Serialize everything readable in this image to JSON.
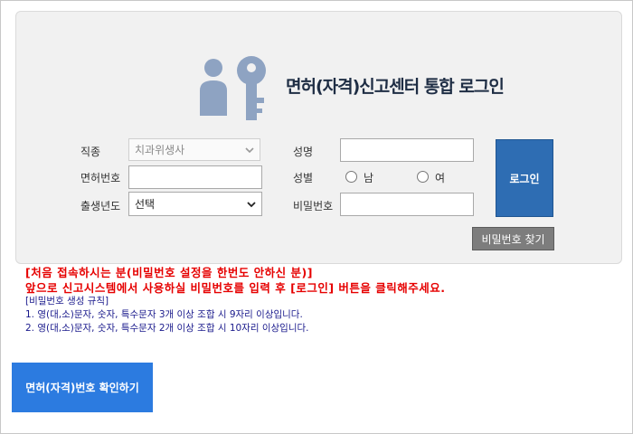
{
  "header": {
    "title": "면허(자격)신고센터 통합 로그인",
    "logo_icon": "user-key-icon"
  },
  "form": {
    "job": {
      "label": "직종",
      "selected": "치과위생사",
      "disabled": true
    },
    "license_no": {
      "label": "면허번호",
      "value": ""
    },
    "birth_year": {
      "label": "출생년도",
      "selected": "선택"
    },
    "name": {
      "label": "성명",
      "value": ""
    },
    "gender": {
      "label": "성별",
      "options": [
        "남",
        "여"
      ]
    },
    "password": {
      "label": "비밀번호",
      "value": ""
    },
    "login_label": "로그인",
    "find_password_label": "비밀번호 찾기"
  },
  "notice": {
    "line1": "[처음 접속하시는 분(비밀번호 설정을 한번도 안하신 분)]",
    "line2": "앞으로 신고시스템에서 사용하실 비밀번호를 입력 후 [로그인] 버튼을 클릭해주세요.",
    "rule_title": "[비밀번호 생성 규칙]",
    "rule1": "1. 영(대,소)문자, 숫자, 특수문자 3개 이상 조합 시 9자리 이상입니다.",
    "rule2": "2. 영(대,소)문자, 숫자, 특수문자 2개 이상 조합 시 10자리 이상입니다."
  },
  "verify_button_label": "면허(자격)번호 확인하기",
  "colors": {
    "login_button": "#2e6db3",
    "find_button": "#7d7d7d",
    "verify_button": "#2c7be0",
    "notice_red": "#e60000",
    "notice_blue": "#1a1a8c",
    "logo": "#8ea3c2"
  }
}
